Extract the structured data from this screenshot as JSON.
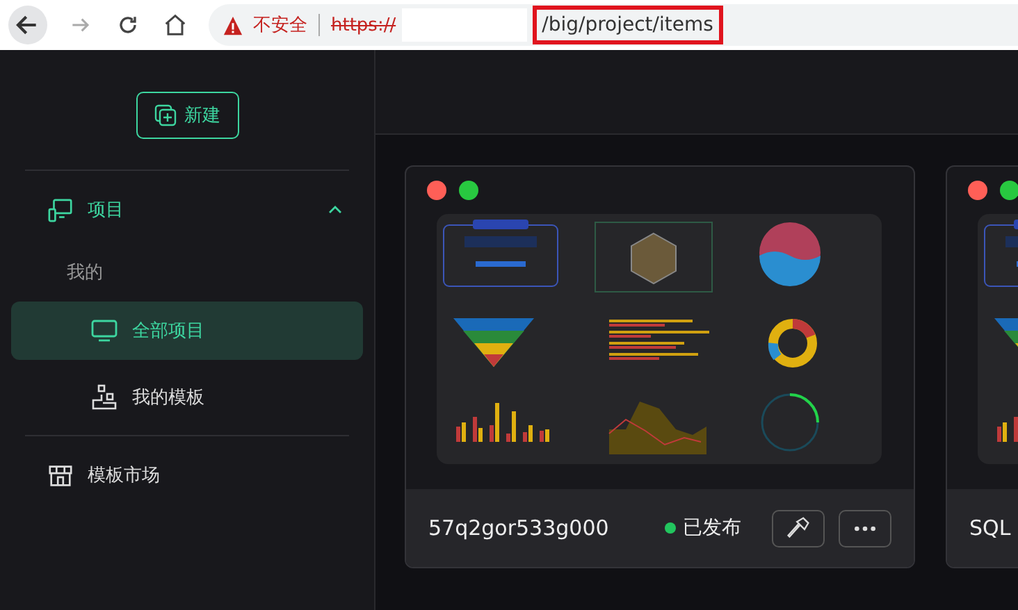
{
  "browser": {
    "security_label": "不安全",
    "url_scheme": "https://",
    "url_path": "/big/project/items",
    "path_highlighted": true
  },
  "sidebar": {
    "new_button": "新建",
    "group": {
      "label": "项目",
      "expanded": true,
      "subheading": "我的",
      "items": [
        {
          "label": "全部项目",
          "selected": true
        },
        {
          "label": "我的模板",
          "selected": false
        }
      ]
    },
    "market_link": "模板市场"
  },
  "projects": [
    {
      "name": "57q2gor533g000",
      "status": "已发布"
    },
    {
      "name": "SQL"
    }
  ]
}
